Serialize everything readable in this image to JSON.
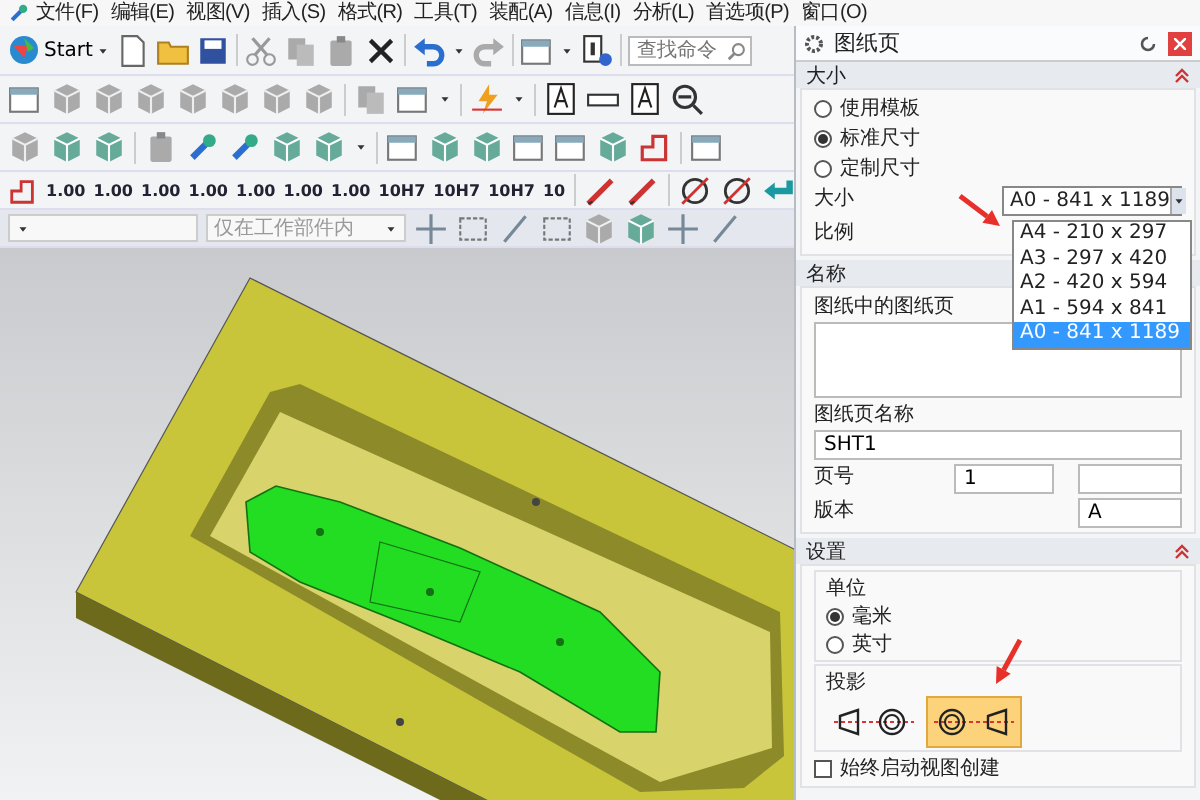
{
  "menu_bar": [
    "文件(F)",
    "编辑(E)",
    "视图(V)",
    "插入(S)",
    "格式(R)",
    "工具(T)",
    "装配(A)",
    "信息(I)",
    "分析(L)",
    "首选项(P)",
    "窗口(O)"
  ],
  "toolbar": {
    "start_label": "Start",
    "search": {
      "placeholder": "查找命令"
    },
    "dimension_styles": [
      "1.00",
      "1.00",
      "1.00",
      "1.00",
      "1.00",
      "1.00",
      "1.00",
      "10H7",
      "10H7",
      "10H7",
      "10"
    ]
  },
  "selection_bar": {
    "scope_filter": "仅在工作部件内"
  },
  "dialog": {
    "title": "图纸页",
    "size_section": {
      "header": "大小",
      "options": [
        {
          "label": "使用模板",
          "selected": false
        },
        {
          "label": "标准尺寸",
          "selected": true
        },
        {
          "label": "定制尺寸",
          "selected": false
        }
      ],
      "size_label": "大小",
      "size_value": "A0 - 841 x 1189",
      "scale_label": "比例",
      "size_list": [
        {
          "label": "A4 - 210 x 297",
          "selected": false
        },
        {
          "label": "A3 - 297 x 420",
          "selected": false
        },
        {
          "label": "A2 - 420 x 594",
          "selected": false
        },
        {
          "label": "A1 - 594 x 841",
          "selected": false
        },
        {
          "label": "A0 - 841 x 1189",
          "selected": true
        }
      ]
    },
    "name_section": {
      "header": "名称",
      "sheets_label": "图纸中的图纸页",
      "sheet_name_label": "图纸页名称",
      "sheet_name_value": "SHT1",
      "page_number_label": "页号",
      "page_number_value": "1",
      "revision_label": "版本",
      "revision_value": "A"
    },
    "settings_section": {
      "header": "设置",
      "units_label": "单位",
      "units": [
        {
          "label": "毫米",
          "selected": true
        },
        {
          "label": "英寸",
          "selected": false
        }
      ],
      "projection_label": "投影",
      "projections": [
        {
          "kind": "first_angle",
          "selected": false
        },
        {
          "kind": "third_angle",
          "selected": true
        }
      ],
      "auto_view_creation": {
        "label": "始终启动视图创建",
        "checked": false
      }
    }
  }
}
